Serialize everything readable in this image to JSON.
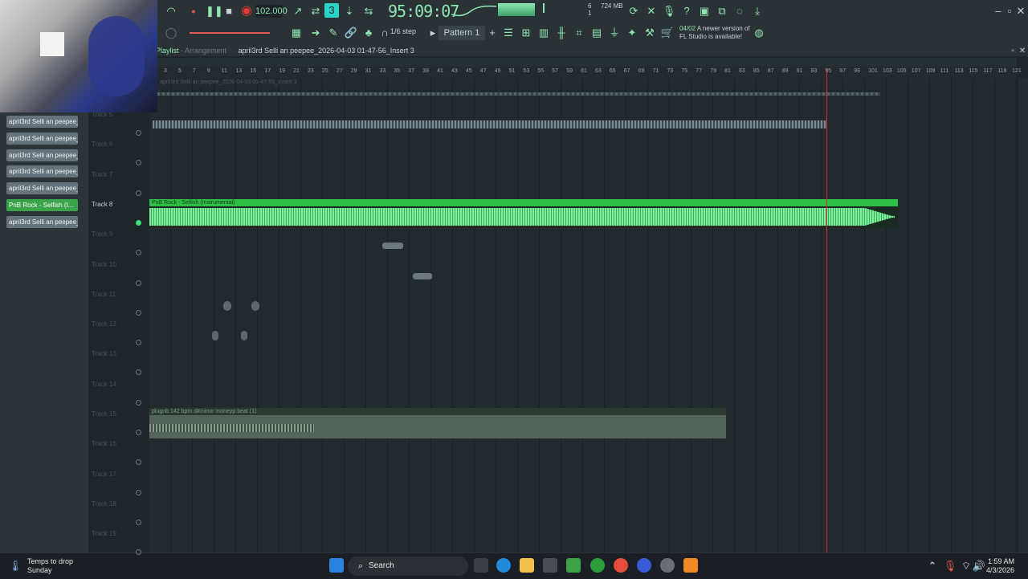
{
  "toolbar": {
    "bpm": "102.000",
    "time": "95:09:07",
    "step": "1/6 step",
    "pattern": "Pattern 1",
    "cpu": "6",
    "cpu2": "1",
    "memory": "724 MB",
    "news_date": "04/02",
    "news_text1": "A newer version of",
    "news_text2": "FL Studio is available!"
  },
  "playlist": {
    "window": "Playlist",
    "sep": "-",
    "mode": "Arrangement",
    "name": "april3rd Selli an peepee_2026-04-03 01-47-56_Insert 3"
  },
  "ruler": [
    "3",
    "5",
    "7",
    "9",
    "11",
    "13",
    "15",
    "17",
    "19",
    "21",
    "23",
    "25",
    "27",
    "29",
    "31",
    "33",
    "35",
    "37",
    "39",
    "41",
    "43",
    "45",
    "47",
    "49",
    "51",
    "53",
    "55",
    "57",
    "59",
    "61",
    "63",
    "65",
    "67",
    "69",
    "71",
    "73",
    "75",
    "77",
    "79",
    "81",
    "83",
    "85",
    "87",
    "89",
    "91",
    "93",
    "95",
    "97",
    "99",
    "101",
    "103",
    "105",
    "107",
    "109",
    "111",
    "113",
    "115",
    "117",
    "119",
    "121"
  ],
  "sidebar_clips": [
    {
      "label": "april3rd Selli an peepee_..."
    },
    {
      "label": "april3rd Selli an peepee_..."
    },
    {
      "label": "april3rd Selli an peepee_..."
    },
    {
      "label": "april3rd Selli an peepee_..."
    },
    {
      "label": "april3rd Selli an peepee_..."
    },
    {
      "label": "PnB Rock - Selfish (I..."
    },
    {
      "label": "april3rd Selli an peepee_..."
    }
  ],
  "tracks": [
    {
      "label": "Track 5"
    },
    {
      "label": "Track 6"
    },
    {
      "label": "Track 7"
    },
    {
      "label": "Track 8"
    },
    {
      "label": "Track 9"
    },
    {
      "label": "Track 10"
    },
    {
      "label": "Track 11"
    },
    {
      "label": "Track 12"
    },
    {
      "label": "Track 13"
    },
    {
      "label": "Track 14"
    },
    {
      "label": "Track 15"
    },
    {
      "label": "Track 16"
    },
    {
      "label": "Track 17"
    },
    {
      "label": "Track 18"
    },
    {
      "label": "Track 19"
    }
  ],
  "clips": {
    "top": "april3rd Selli an peepee_2026-04-03 01-47-56_Insert 3",
    "selfish": "PnB Rock - Selfish (Instrumental)",
    "plugnb": "plugnb 142 bpm d#minor moneyp beat (1)"
  },
  "taskbar": {
    "weather_title": "Temps to drop",
    "weather_sub": "Sunday",
    "search": "Search",
    "time": "1:59 AM",
    "date": "4/3/2026"
  },
  "colors": {
    "accent": "#8fe6b0",
    "selected_clip": "#3aa44a",
    "playhead": "#d32f2f"
  }
}
